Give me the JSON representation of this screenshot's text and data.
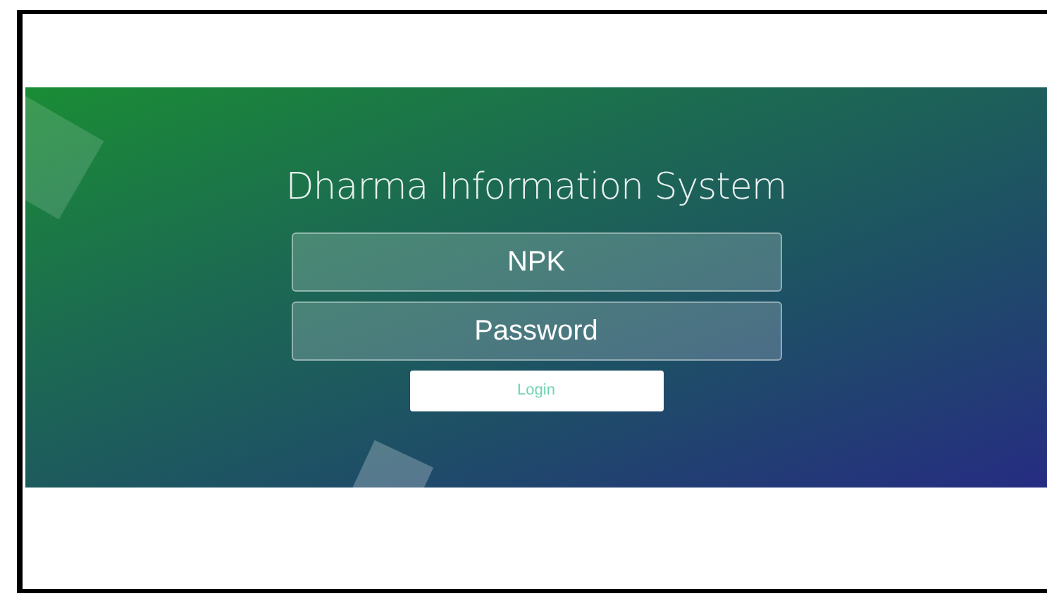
{
  "login_form": {
    "title": "Dharma Information System",
    "fields": [
      {
        "placeholder": "NPK"
      },
      {
        "placeholder": "Password"
      }
    ],
    "login_button": {
      "label": "Login"
    }
  }
}
